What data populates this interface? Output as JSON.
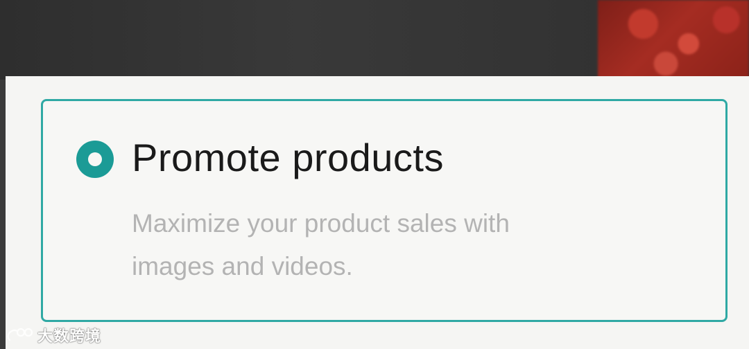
{
  "option": {
    "title": "Promote products",
    "description": "Maximize your product sales with images and videos.",
    "selected": true
  },
  "colors": {
    "accent": "#2fa9a4",
    "radio_fill": "#1b9b96",
    "title_text": "#1a1a1a",
    "description_text": "#b3b3b3",
    "sheet_background": "#f5f5f3"
  },
  "watermark": {
    "text": "大数跨境",
    "icon": "weibo-like-logo-icon"
  }
}
